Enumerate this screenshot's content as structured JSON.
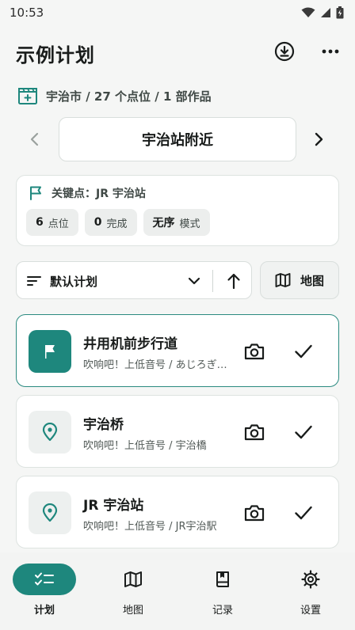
{
  "status": {
    "time": "10:53"
  },
  "header": {
    "title": "示例计划"
  },
  "info": {
    "summary": "宇治市 / 27 个点位 / 1 部作品"
  },
  "segment": {
    "current": "宇治站附近"
  },
  "key_card": {
    "title": "关键点：JR 宇治站",
    "chips": [
      {
        "num": "6",
        "label": "点位"
      },
      {
        "num": "0",
        "label": "完成"
      },
      {
        "num": "无序",
        "label": "模式"
      }
    ]
  },
  "sort": {
    "label": "默认计划"
  },
  "map_button": {
    "label": "地图"
  },
  "spots": [
    {
      "title": "井用机前步行道",
      "subtitle": "吹响吧！上低音号 / あじろぎの道",
      "icon": "flag-icon",
      "active": true
    },
    {
      "title": "宇治桥",
      "subtitle": "吹响吧！上低音号 / 宇治橋",
      "icon": "location-pin-icon",
      "active": false
    },
    {
      "title": "JR 宇治站",
      "subtitle": "吹响吧！上低音号 / JR宇治駅",
      "icon": "location-pin-icon",
      "active": false
    }
  ],
  "nav": {
    "items": [
      {
        "label": "计划",
        "icon": "checklist-icon",
        "active": true
      },
      {
        "label": "地图",
        "icon": "map-icon",
        "active": false
      },
      {
        "label": "记录",
        "icon": "book-icon",
        "active": false
      },
      {
        "label": "设置",
        "icon": "gear-icon",
        "active": false
      }
    ]
  },
  "colors": {
    "accent": "#1e877d",
    "accent_border": "#2a8a80",
    "background": "#f5f6f5"
  }
}
